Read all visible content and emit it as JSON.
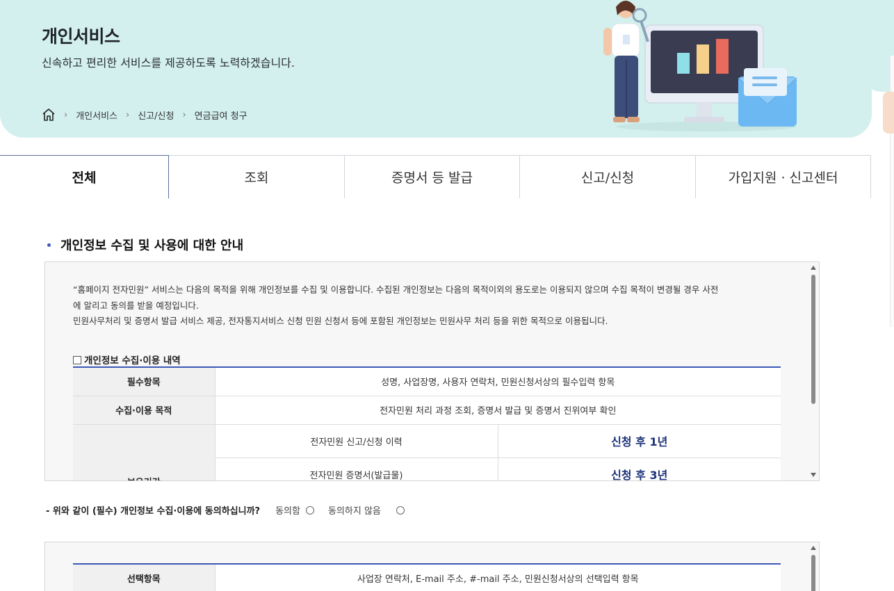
{
  "header": {
    "title": "개인서비스",
    "subtitle": "신속하고 편리한 서비스를 제공하도록 노력하겠습니다.",
    "breadcrumb": [
      "개인서비스",
      "신고/신청",
      "연금급여 청구"
    ]
  },
  "tabs": [
    {
      "label": "전체",
      "active": true
    },
    {
      "label": "조회",
      "active": false
    },
    {
      "label": "증명서 등 발급",
      "active": false
    },
    {
      "label": "신고/신청",
      "active": false
    },
    {
      "label": "가입지원 · 신고센터",
      "active": false
    }
  ],
  "section": {
    "title": "개인정보 수집 및 사용에 대한 안내",
    "intro_line1": "“홈페이지 전자민원” 서비스는 다음의 목적을 위해 개인정보를 수집 및 이용합니다. 수집된 개인정보는 다음의 목적이외의 용도로는 이용되지 않으며 수집 목적이 변경될 경우 사전",
    "intro_line2": "에 알리고 동의를 받을 예정입니다.",
    "intro_line3": "민원사무처리 및 증명서 발급 서비스 제공, 전자통지서비스 신청 민원 신청서 등에 포함된 개인정보는 민원사무 처리 등을 위한 목적으로 이용됩니다.",
    "table_caption": "개인정보 수집·이용 내역",
    "rows": {
      "required_label": "필수항목",
      "required_value": "성명, 사업장명, 사용자 연락처, 민원신청서상의 필수입력 항목",
      "purpose_label": "수집·이용 목적",
      "purpose_value": "전자민원 처리 과정 조회, 증명서 발급 및 증명서 진위여부 확인",
      "retention_label": "보유기간",
      "retention": [
        {
          "item": "전자민원 신고/신청 이력",
          "period": "신청 후 1년"
        },
        {
          "item": "전자민원 증명서(발급물)",
          "period": "신청 후 3년"
        }
      ]
    }
  },
  "consent": {
    "question": "- 위와 같이 (필수) 개인정보 수집·이용에 동의하십니까?",
    "agree": "동의함",
    "disagree": "동의하지 않음"
  },
  "optional": {
    "label": "선택항목",
    "value": "사업장 연락처, E-mail 주소, #-mail 주소, 민원신청서상의 선택입력 항목"
  }
}
